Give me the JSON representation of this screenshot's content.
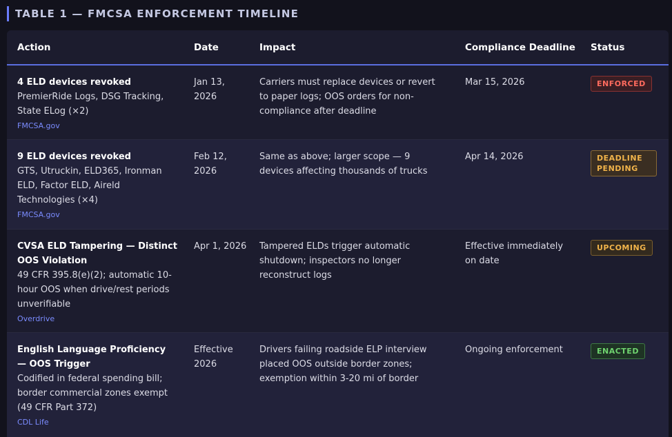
{
  "title": "TABLE 1 — FMCSA ENFORCEMENT TIMELINE",
  "columns": [
    "Action",
    "Date",
    "Impact",
    "Compliance Deadline",
    "Status"
  ],
  "rows": [
    {
      "action_title": "4 ELD devices revoked",
      "action_detail": "PremierRide Logs, DSG Tracking, State ELog (×2)",
      "source": "FMCSA.gov",
      "date": "Jan 13, 2026",
      "impact": "Carriers must replace devices or revert to paper logs; OOS orders for non-compliance after deadline",
      "deadline": "Mar 15, 2026",
      "status": "ENFORCED"
    },
    {
      "action_title": "9 ELD devices revoked",
      "action_detail": "GTS, Utruckin, ELD365, Ironman ELD, Factor ELD, Aireld Technologies (×4)",
      "source": "FMCSA.gov",
      "date": "Feb 12, 2026",
      "impact": "Same as above; larger scope — 9 devices affecting thousands of trucks",
      "deadline": "Apr 14, 2026",
      "status": "DEADLINE PENDING"
    },
    {
      "action_title": "CVSA ELD Tampering — Distinct OOS Violation",
      "action_detail": "49 CFR 395.8(e)(2); automatic 10-hour OOS when drive/rest periods unverifiable",
      "source": "Overdrive",
      "date": "Apr 1, 2026",
      "impact": "Tampered ELDs trigger automatic shutdown; inspectors no longer reconstruct logs",
      "deadline": "Effective immediately on date",
      "status": "UPCOMING"
    },
    {
      "action_title": "English Language Proficiency — OOS Trigger",
      "action_detail": "Codified in federal spending bill; border commercial zones exempt (49 CFR Part 372)",
      "source": "CDL Life",
      "date": "Effective 2026",
      "impact": "Drivers failing roadside ELP interview placed OOS outside border zones; exemption within 3-20 mi of border",
      "deadline": "Ongoing enforcement",
      "status": "ENACTED"
    }
  ],
  "colors": {
    "accent": "#5b6ee0",
    "enforced": "#ff6b5e",
    "pending": "#f0b34a",
    "upcoming": "#f0b34a",
    "enacted": "#6fd36f",
    "source_link": "#7b8cff"
  }
}
